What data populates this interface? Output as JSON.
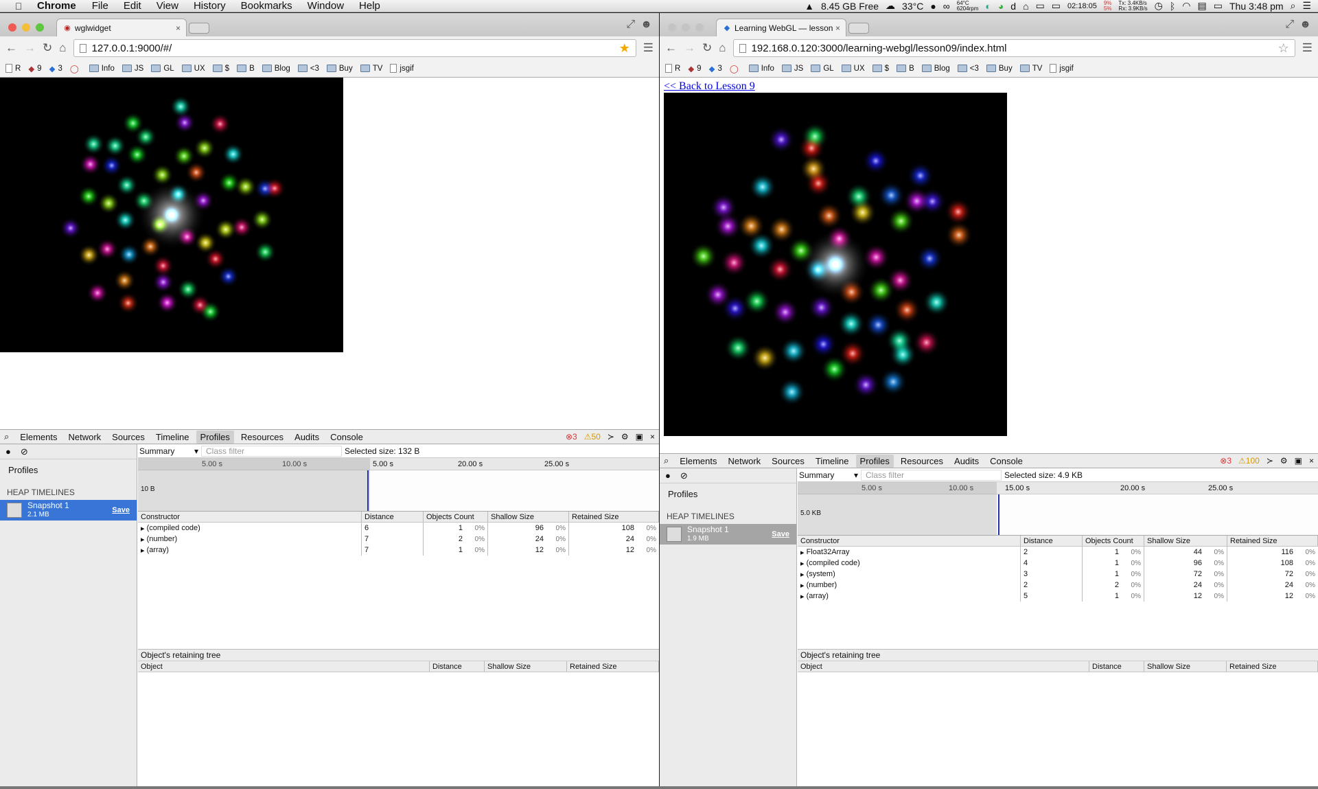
{
  "menubar": {
    "apple": "",
    "app_name": "Chrome",
    "items": [
      "File",
      "Edit",
      "View",
      "History",
      "Bookmarks",
      "Window",
      "Help"
    ],
    "status": {
      "disk_free": "8.45 GB Free",
      "temp": "33°C",
      "cpu_temp": "64°C",
      "fan": "6204rpm",
      "timer": "02:18:05",
      "cpu_pct_top": "9%",
      "cpu_pct_bottom": "5%",
      "net_tx": "Tx: 3.4KB/s",
      "net_rx": "Rx: 3.9KB/s",
      "clock": "Thu 3:48 pm"
    }
  },
  "left_window": {
    "tab_title": "wglwidget",
    "url": "127.0.0.1:9000/#/",
    "bookmarks": [
      {
        "label": "R",
        "type": "page"
      },
      {
        "label": "9",
        "type": "badge"
      },
      {
        "label": "3",
        "type": "badge"
      },
      {
        "label": "",
        "type": "icon"
      },
      {
        "label": "Info",
        "type": "folder"
      },
      {
        "label": "JS",
        "type": "folder"
      },
      {
        "label": "GL",
        "type": "folder"
      },
      {
        "label": "UX",
        "type": "folder"
      },
      {
        "label": "$",
        "type": "folder"
      },
      {
        "label": "B",
        "type": "folder"
      },
      {
        "label": "Blog",
        "type": "folder"
      },
      {
        "label": "<3",
        "type": "folder"
      },
      {
        "label": "Buy",
        "type": "folder"
      },
      {
        "label": "TV",
        "type": "folder"
      },
      {
        "label": "jsgif",
        "type": "page"
      }
    ],
    "devtools": {
      "tabs": [
        "Elements",
        "Network",
        "Sources",
        "Timeline",
        "Profiles",
        "Resources",
        "Audits",
        "Console"
      ],
      "active_tab": "Profiles",
      "errors": "3",
      "warnings": "50",
      "sidebar_title": "Profiles",
      "section": "HEAP TIMELINES",
      "snapshot_name": "Snapshot 1",
      "snapshot_size": "2.1 MB",
      "save": "Save",
      "summary": "Summary",
      "class_filter": "Class filter",
      "selected_size": "Selected size: 132 B",
      "ticks": [
        "5.00 s",
        "10.00 s",
        "5.00 s",
        "20.00 s",
        "25.00 s"
      ],
      "timeline_label": "10 B",
      "columns": [
        "Constructor",
        "Distance",
        "Objects Count",
        "Shallow Size",
        "Retained Size"
      ],
      "rows": [
        {
          "name": "(compiled code)",
          "distance": "6",
          "count": "1",
          "count_pct": "0%",
          "shallow": "96",
          "shallow_pct": "0%",
          "retained": "108",
          "retained_pct": "0%"
        },
        {
          "name": "(number)",
          "distance": "7",
          "count": "2",
          "count_pct": "0%",
          "shallow": "24",
          "shallow_pct": "0%",
          "retained": "24",
          "retained_pct": "0%"
        },
        {
          "name": "(array)",
          "distance": "7",
          "count": "1",
          "count_pct": "0%",
          "shallow": "12",
          "shallow_pct": "0%",
          "retained": "12",
          "retained_pct": "0%"
        }
      ],
      "retaining_title": "Object's retaining tree",
      "retaining_columns": [
        "Object",
        "Distance",
        "Shallow Size",
        "Retained Size"
      ]
    }
  },
  "right_window": {
    "tab_title": "Learning WebGL — lesson",
    "url": "192.168.0.120:3000/learning-webgl/lesson09/index.html",
    "back_link": "<< Back to Lesson 9",
    "devtools": {
      "tabs": [
        "Elements",
        "Network",
        "Sources",
        "Timeline",
        "Profiles",
        "Resources",
        "Audits",
        "Console"
      ],
      "active_tab": "Profiles",
      "errors": "3",
      "warnings": "100",
      "sidebar_title": "Profiles",
      "section": "HEAP TIMELINES",
      "snapshot_name": "Snapshot 1",
      "snapshot_size": "1.9 MB",
      "save": "Save",
      "summary": "Summary",
      "class_filter": "Class filter",
      "selected_size": "Selected size: 4.9 KB",
      "ticks": [
        "5.00 s",
        "10.00 s",
        "15.00 s",
        "20.00 s",
        "25.00 s"
      ],
      "timeline_label": "5.0 KB",
      "columns": [
        "Constructor",
        "Distance",
        "Objects Count",
        "Shallow Size",
        "Retained Size"
      ],
      "rows": [
        {
          "name": "Float32Array",
          "distance": "2",
          "count": "1",
          "count_pct": "0%",
          "shallow": "44",
          "shallow_pct": "0%",
          "retained": "116",
          "retained_pct": "0%"
        },
        {
          "name": "(compiled code)",
          "distance": "4",
          "count": "1",
          "count_pct": "0%",
          "shallow": "96",
          "shallow_pct": "0%",
          "retained": "108",
          "retained_pct": "0%"
        },
        {
          "name": "(system)",
          "distance": "3",
          "count": "1",
          "count_pct": "0%",
          "shallow": "72",
          "shallow_pct": "0%",
          "retained": "72",
          "retained_pct": "0%"
        },
        {
          "name": "(number)",
          "distance": "2",
          "count": "2",
          "count_pct": "0%",
          "shallow": "24",
          "shallow_pct": "0%",
          "retained": "24",
          "retained_pct": "0%"
        },
        {
          "name": "(array)",
          "distance": "5",
          "count": "1",
          "count_pct": "0%",
          "shallow": "12",
          "shallow_pct": "0%",
          "retained": "12",
          "retained_pct": "0%"
        }
      ],
      "retaining_title": "Object's retaining tree",
      "retaining_columns": [
        "Object",
        "Distance",
        "Shallow Size",
        "Retained Size"
      ]
    }
  },
  "colors": {
    "selection_blue": "#3875d7",
    "timeline_marker": "#2630a8",
    "link_blue": "#0000ee",
    "error_red": "#dd3333",
    "warning_yellow": "#d49a00"
  }
}
